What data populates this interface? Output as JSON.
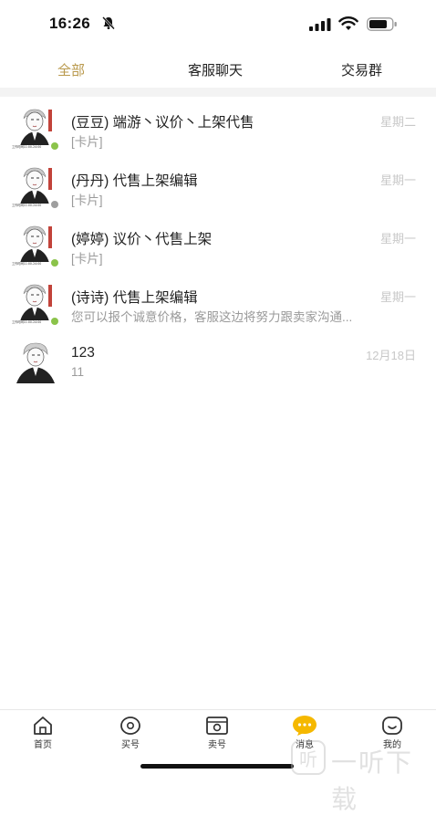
{
  "status_bar": {
    "time": "16:26"
  },
  "tabs": [
    {
      "label": "全部",
      "active": true
    },
    {
      "label": "客服聊天",
      "active": false
    },
    {
      "label": "交易群",
      "active": false
    }
  ],
  "conversations": [
    {
      "title": "(豆豆) 端游丶议价丶上架代售",
      "subtitle": "[卡片]",
      "time": "星期二",
      "online_color": "#8bc34a"
    },
    {
      "title": "(丹丹) 代售上架编辑",
      "subtitle": "[卡片]",
      "time": "星期一",
      "online_color": "#9e9e9e"
    },
    {
      "title": "(婷婷) 议价丶代售上架",
      "subtitle": "[卡片]",
      "time": "星期一",
      "online_color": "#8bc34a"
    },
    {
      "title": "(诗诗) 代售上架编辑",
      "subtitle": "您可以报个诚意价格，客服这边将努力跟卖家沟通...",
      "time": "星期一",
      "online_color": "#8bc34a"
    },
    {
      "title": "123",
      "subtitle": "11",
      "time": "12月18日",
      "online_color": ""
    }
  ],
  "bottom_nav": [
    {
      "label": "首页",
      "icon": "home-icon"
    },
    {
      "label": "买号",
      "icon": "buy-icon"
    },
    {
      "label": "卖号",
      "icon": "sell-icon"
    },
    {
      "label": "消息",
      "icon": "message-icon"
    },
    {
      "label": "我的",
      "icon": "profile-icon"
    }
  ],
  "watermark": {
    "text": "一听下载"
  },
  "colors": {
    "accent": "#b9994c",
    "message_active": "#f5b800",
    "muted": "#9a9a9a",
    "time": "#c8c8c8"
  }
}
